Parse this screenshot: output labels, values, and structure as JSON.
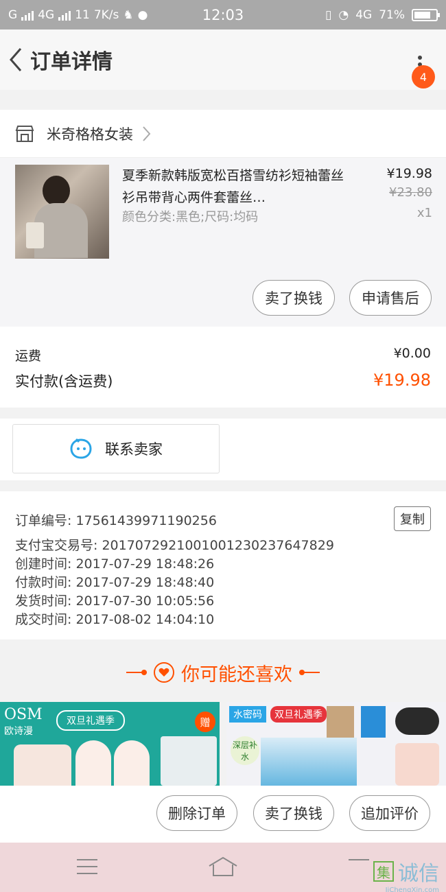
{
  "status_bar": {
    "carrier_1": "G",
    "carrier_2": "4G",
    "carrier_3": "11",
    "net_speed": "7K/s",
    "time": "12:03",
    "network_right": "4G",
    "battery": "71%"
  },
  "nav": {
    "title": "订单详情",
    "badge_count": "4"
  },
  "store": {
    "name": "米奇格格女装"
  },
  "product": {
    "title": "夏季新款韩版宽松百搭雪纺衫短袖蕾丝衫吊带背心两件套蕾丝…",
    "spec": "颜色分类:黑色;尺码:均码",
    "price": "¥19.98",
    "original_price": "¥23.80",
    "quantity": "x1",
    "sell_button": "卖了换钱",
    "after_sale_button": "申请售后"
  },
  "fees": {
    "shipping_label": "运费",
    "shipping_value": "¥0.00",
    "paid_label": "实付款(含运费)",
    "paid_value": "¥19.98"
  },
  "contact": {
    "label": "联系卖家"
  },
  "order_info": {
    "order_no": "订单编号: 17561439971190256",
    "copy_button": "复制",
    "alipay_no": "支付宝交易号: 2017072921001001230237647829",
    "created": "创建时间: 2017-07-29  18:48:26",
    "paid": "付款时间: 2017-07-29  18:48:40",
    "shipped": "发货时间: 2017-07-30  10:05:56",
    "completed": "成交时间: 2017-08-02  14:04:10"
  },
  "recommend": {
    "title": "你可能还喜欢",
    "ad1_brand": "OSM",
    "ad1_brand_cn": "欧诗漫",
    "ad1_promo": "双旦礼遇季",
    "ad1_gift": "赠",
    "ad2_brand": "水密码",
    "ad2_promo": "双旦礼遇季",
    "ad2_tag": "深层补水"
  },
  "bottom_actions": {
    "delete": "删除订单",
    "sell": "卖了换钱",
    "review": "追加评价"
  },
  "watermark": {
    "text": "诚信",
    "sub": "JiChengXin.com"
  },
  "colors": {
    "accent": "#ff5000",
    "badge": "#ff5a1a",
    "ad1_bg": "#1fa79a"
  }
}
